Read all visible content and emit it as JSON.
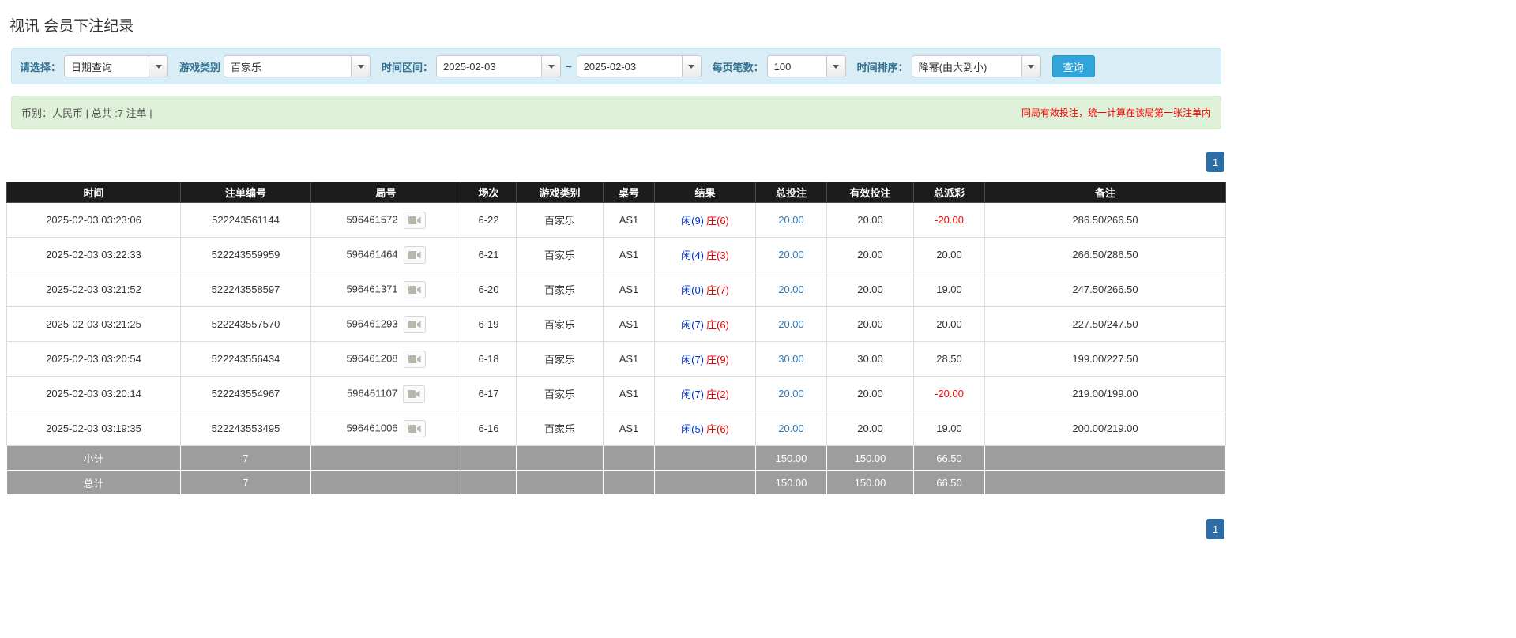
{
  "page": {
    "title": "视讯 会员下注纪录"
  },
  "filters": {
    "query_type_label": "请选择：",
    "query_type_value": "日期查询",
    "game_type_label": "游戏类别",
    "game_type_value": "百家乐",
    "date_range_label": "时间区间：",
    "date_from": "2025-02-03",
    "date_separator": "~",
    "date_to": "2025-02-03",
    "page_size_label": "每页笔数：",
    "page_size_value": "100",
    "sort_label": "时间排序：",
    "sort_value": "降幂(由大到小)",
    "search_button": "查询"
  },
  "summary": {
    "left": "币别：人民币 | 总共 :7 注单 |",
    "notice": "同局有效投注，统一计算在该局第一张注单内"
  },
  "pagination": {
    "page": "1"
  },
  "table": {
    "headers": [
      "时间",
      "注单编号",
      "局号",
      "场次",
      "游戏类别",
      "桌号",
      "结果",
      "总投注",
      "有效投注",
      "总派彩",
      "备注"
    ],
    "rows": [
      {
        "time": "2025-02-03 03:23:06",
        "bet_id": "522243561144",
        "round_id": "596461572",
        "session": "6-22",
        "game": "百家乐",
        "table_no": "AS1",
        "result_player": "闲(9)",
        "result_banker": "庄(6)",
        "total_bet": "20.00",
        "valid_bet": "20.00",
        "payout": "-20.00",
        "note": "286.50/266.50"
      },
      {
        "time": "2025-02-03 03:22:33",
        "bet_id": "522243559959",
        "round_id": "596461464",
        "session": "6-21",
        "game": "百家乐",
        "table_no": "AS1",
        "result_player": "闲(4)",
        "result_banker": "庄(3)",
        "total_bet": "20.00",
        "valid_bet": "20.00",
        "payout": "20.00",
        "note": "266.50/286.50"
      },
      {
        "time": "2025-02-03 03:21:52",
        "bet_id": "522243558597",
        "round_id": "596461371",
        "session": "6-20",
        "game": "百家乐",
        "table_no": "AS1",
        "result_player": "闲(0)",
        "result_banker": "庄(7)",
        "total_bet": "20.00",
        "valid_bet": "20.00",
        "payout": "19.00",
        "note": "247.50/266.50"
      },
      {
        "time": "2025-02-03 03:21:25",
        "bet_id": "522243557570",
        "round_id": "596461293",
        "session": "6-19",
        "game": "百家乐",
        "table_no": "AS1",
        "result_player": "闲(7)",
        "result_banker": "庄(6)",
        "total_bet": "20.00",
        "valid_bet": "20.00",
        "payout": "20.00",
        "note": "227.50/247.50"
      },
      {
        "time": "2025-02-03 03:20:54",
        "bet_id": "522243556434",
        "round_id": "596461208",
        "session": "6-18",
        "game": "百家乐",
        "table_no": "AS1",
        "result_player": "闲(7)",
        "result_banker": "庄(9)",
        "total_bet": "30.00",
        "valid_bet": "30.00",
        "payout": "28.50",
        "note": "199.00/227.50"
      },
      {
        "time": "2025-02-03 03:20:14",
        "bet_id": "522243554967",
        "round_id": "596461107",
        "session": "6-17",
        "game": "百家乐",
        "table_no": "AS1",
        "result_player": "闲(7)",
        "result_banker": "庄(2)",
        "total_bet": "20.00",
        "valid_bet": "20.00",
        "payout": "-20.00",
        "note": "219.00/199.00"
      },
      {
        "time": "2025-02-03 03:19:35",
        "bet_id": "522243553495",
        "round_id": "596461006",
        "session": "6-16",
        "game": "百家乐",
        "table_no": "AS1",
        "result_player": "闲(5)",
        "result_banker": "庄(6)",
        "total_bet": "20.00",
        "valid_bet": "20.00",
        "payout": "19.00",
        "note": "200.00/219.00"
      }
    ],
    "subtotal": {
      "label": "小计",
      "count": "7",
      "total_bet": "150.00",
      "valid_bet": "150.00",
      "payout": "66.50"
    },
    "grand_total": {
      "label": "总计",
      "count": "7",
      "total_bet": "150.00",
      "valid_bet": "150.00",
      "payout": "66.50"
    }
  }
}
